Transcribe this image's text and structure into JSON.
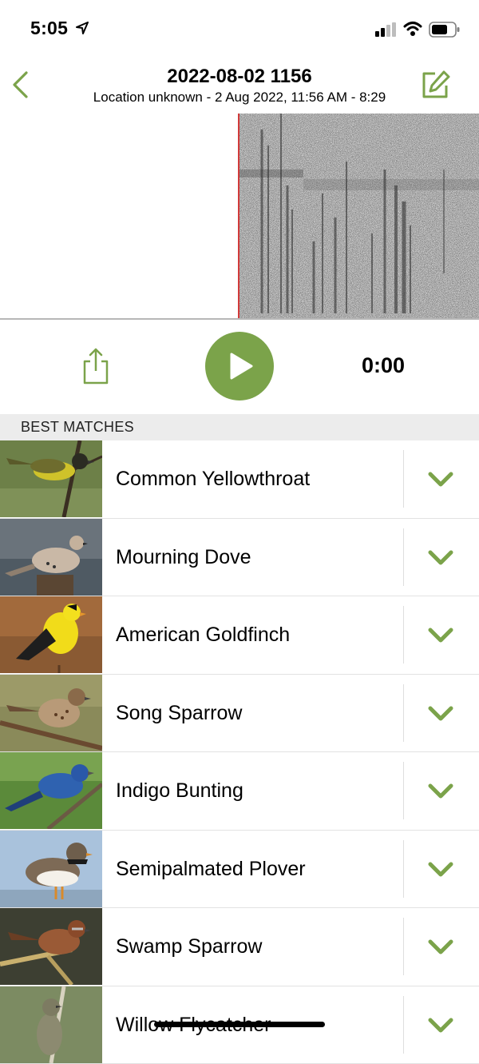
{
  "status_bar": {
    "time": "5:05",
    "location_icon": "location-arrow-icon",
    "signal_icon": "signal-bars-icon",
    "wifi_icon": "wifi-icon",
    "battery_icon": "battery-icon"
  },
  "nav": {
    "title": "2022-08-02 1156",
    "subtitle": "Location unknown - 2 Aug 2022, 11:56 AM - 8:29",
    "back_icon": "chevron-left-icon",
    "edit_icon": "edit-pencil-icon"
  },
  "playback": {
    "time": "0:00",
    "share_icon": "share-icon",
    "play_icon": "play-icon"
  },
  "colors": {
    "accent": "#7ba34a",
    "playhead": "#d23a3a",
    "section_bg": "#ececec"
  },
  "section": {
    "label": "BEST MATCHES"
  },
  "matches": [
    {
      "name": "Common Yellowthroat"
    },
    {
      "name": "Mourning Dove"
    },
    {
      "name": "American Goldfinch"
    },
    {
      "name": "Song Sparrow"
    },
    {
      "name": "Indigo Bunting"
    },
    {
      "name": "Semipalmated Plover"
    },
    {
      "name": "Swamp Sparrow"
    },
    {
      "name": "Willow Flycatcher"
    }
  ]
}
